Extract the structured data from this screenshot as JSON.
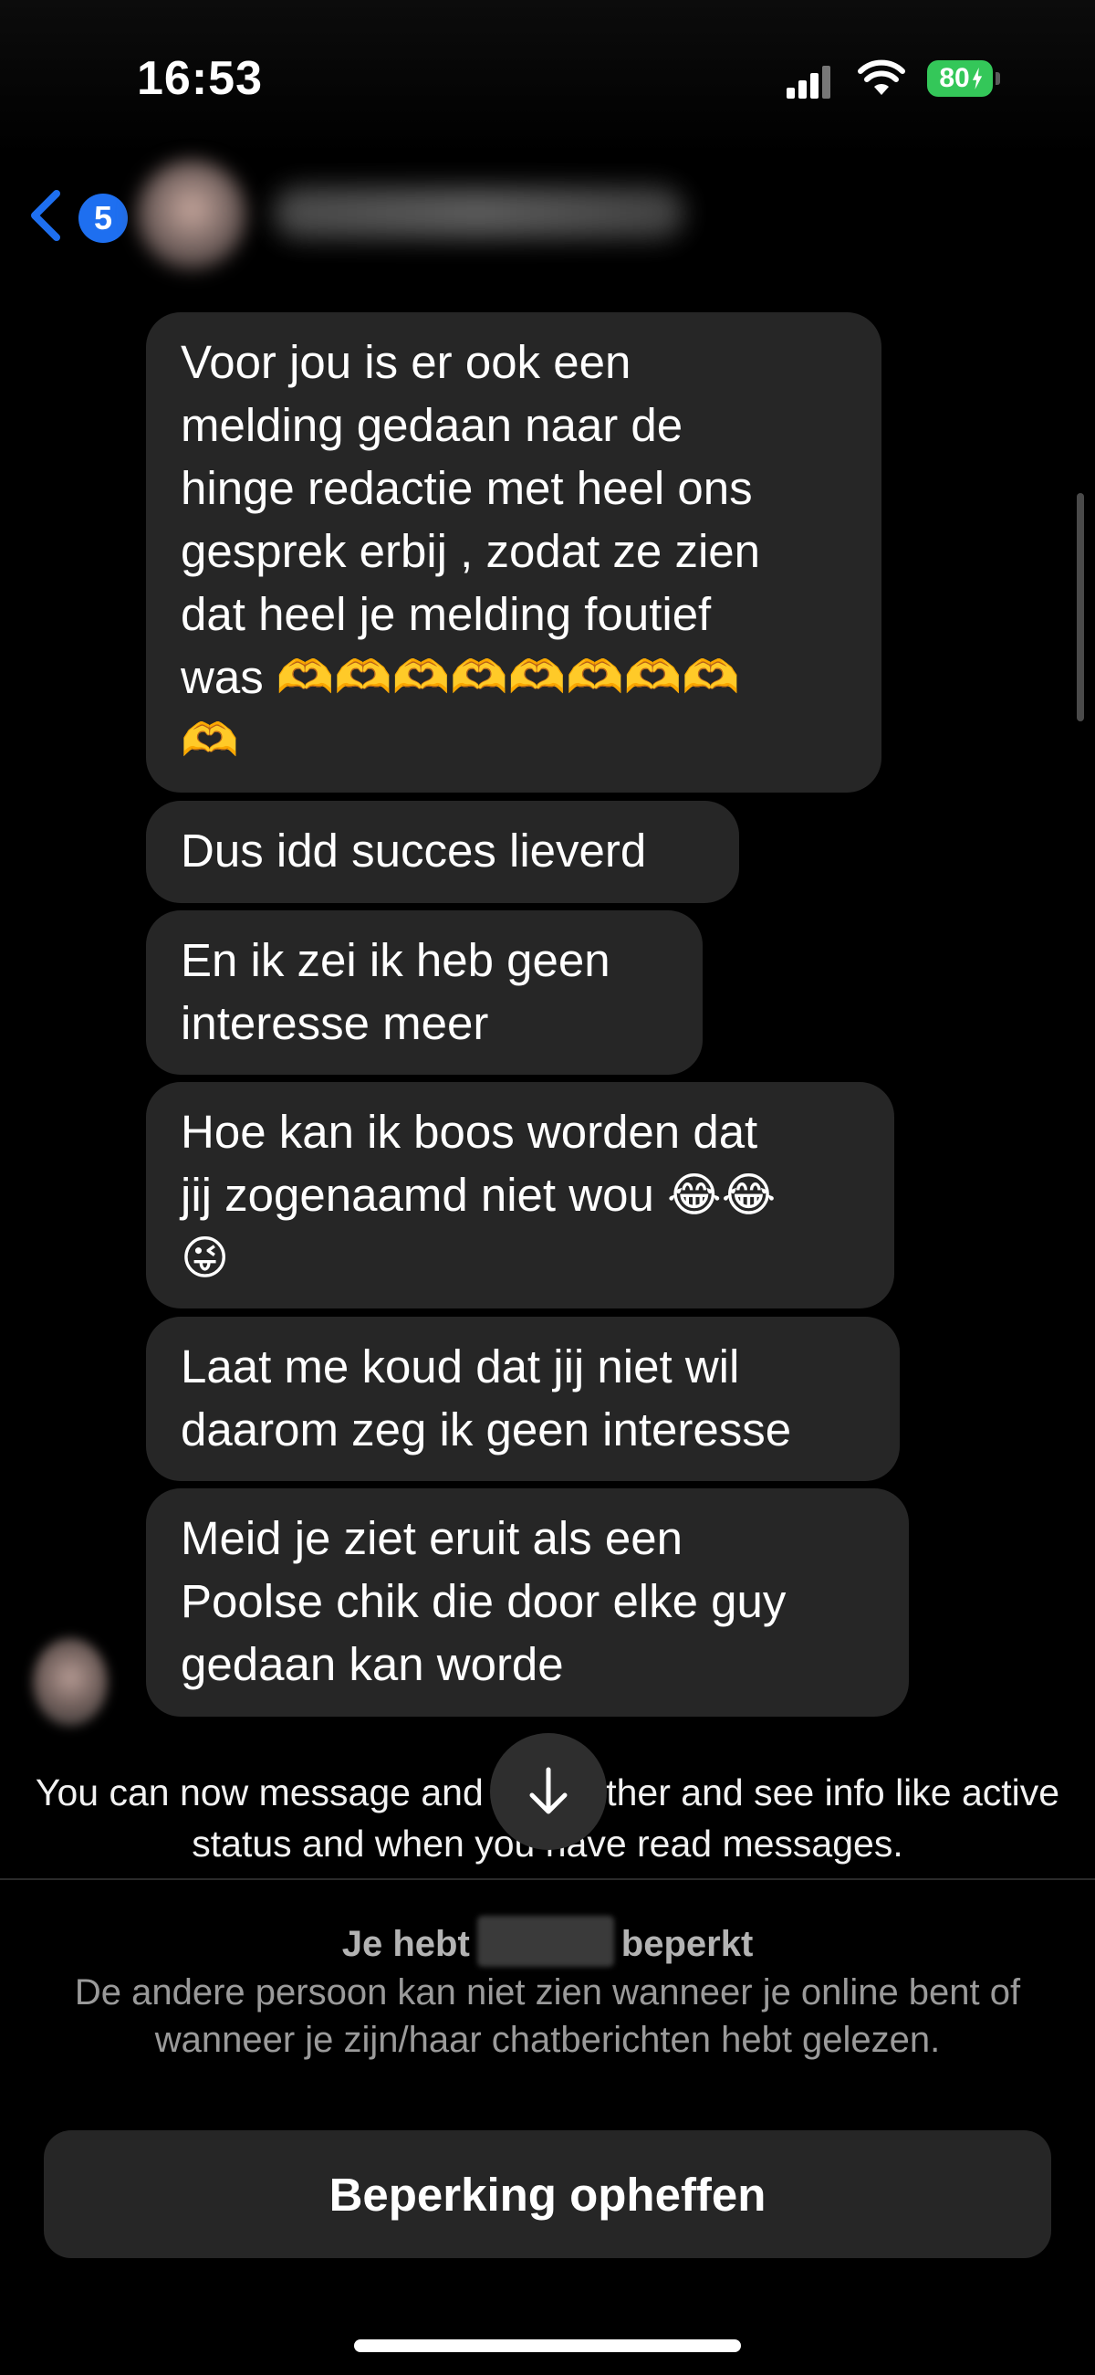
{
  "status_bar": {
    "time": "16:53",
    "battery_level": "80"
  },
  "header": {
    "back_count": "5",
    "contact_name": "(blurred)"
  },
  "messages": [
    {
      "text": "Voor jou is er ook een\nmelding gedaan naar de\nhinge redactie met heel ons\ngesprek erbij , zodat ze zien\ndat heel je melding foutief\nwas 🫶🫶🫶🫶🫶🫶🫶🫶\n🫶"
    },
    {
      "text": "Dus idd succes lieverd"
    },
    {
      "text": "En ik zei ik heb geen\ninteresse meer"
    },
    {
      "text": "Hoe kan ik boos worden dat\njij zogenaamd niet wou 😂😂\n😜"
    },
    {
      "text": "Laat me koud dat jij niet wil\ndaarom zeg ik geen interesse"
    },
    {
      "text": "Meid je ziet eruit als een\nPoolse chik die door elke guy\ngedaan kan worde"
    }
  ],
  "info_note": "You can now message and each other and see info like active status and when you have read messages.",
  "restriction": {
    "title_prefix": "Je hebt",
    "title_suffix": "beperkt",
    "description": "De andere persoon kan niet zien wanneer je online bent of wanneer je zijn/haar chatberichten hebt gelezen.",
    "button_label": "Beperking opheffen"
  },
  "colors": {
    "background": "#000000",
    "bubble": "#262626",
    "badge_blue": "#1e6ff0",
    "battery_green": "#34c759"
  }
}
